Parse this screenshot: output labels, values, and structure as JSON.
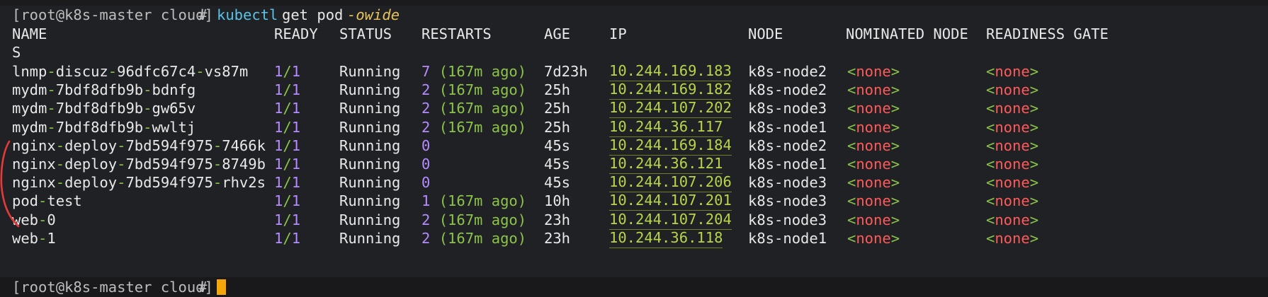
{
  "terminal": {
    "prompt_user_host": "[root@k8s-master cloud]",
    "prompt_symbol": "#",
    "command": "kubectl",
    "command_args": "get pod",
    "command_flag": "-owide",
    "headers": {
      "name": "NAME",
      "ready": "READY",
      "status": "STATUS",
      "restarts": "RESTARTS",
      "age": "AGE",
      "ip": "IP",
      "node": "NODE",
      "nominated_node": "NOMINATED NODE",
      "readiness_gate": "READINESS GATE",
      "readiness_gate_tail": "S"
    },
    "rows": [
      {
        "name_a": "lnmp",
        "name_b": "discuz",
        "name_c": "96dfc67c4",
        "name_d": "vs87m",
        "ready_num": "1",
        "ready_den": "1",
        "status": "Running",
        "restarts": "7",
        "ago": "(167m ago)",
        "age": "7d23h",
        "ip": "10.244.169.183",
        "node": "k8s-node2",
        "nominated": "none",
        "readiness": "none"
      },
      {
        "name_a": "mydm",
        "name_b": "7bdf8dfb9b",
        "name_c": "bdnfg",
        "name_d": "",
        "ready_num": "1",
        "ready_den": "1",
        "status": "Running",
        "restarts": "2",
        "ago": "(167m ago)",
        "age": "25h",
        "ip": "10.244.169.182",
        "node": "k8s-node2",
        "nominated": "none",
        "readiness": "none"
      },
      {
        "name_a": "mydm",
        "name_b": "7bdf8dfb9b",
        "name_c": "gw65v",
        "name_d": "",
        "ready_num": "1",
        "ready_den": "1",
        "status": "Running",
        "restarts": "2",
        "ago": "(167m ago)",
        "age": "25h",
        "ip": "10.244.107.202",
        "node": "k8s-node3",
        "nominated": "none",
        "readiness": "none"
      },
      {
        "name_a": "mydm",
        "name_b": "7bdf8dfb9b",
        "name_c": "wwltj",
        "name_d": "",
        "ready_num": "1",
        "ready_den": "1",
        "status": "Running",
        "restarts": "2",
        "ago": "(167m ago)",
        "age": "25h",
        "ip": "10.244.36.117",
        "node": "k8s-node1",
        "nominated": "none",
        "readiness": "none"
      },
      {
        "name_a": "nginx",
        "name_b": "deploy",
        "name_c": "7bd594f975",
        "name_d": "7466k",
        "ready_num": "1",
        "ready_den": "1",
        "status": "Running",
        "restarts": "0",
        "ago": "",
        "age": "45s",
        "ip": "10.244.169.184",
        "node": "k8s-node2",
        "nominated": "none",
        "readiness": "none"
      },
      {
        "name_a": "nginx",
        "name_b": "deploy",
        "name_c": "7bd594f975",
        "name_d": "8749b",
        "ready_num": "1",
        "ready_den": "1",
        "status": "Running",
        "restarts": "0",
        "ago": "",
        "age": "45s",
        "ip": "10.244.36.121",
        "node": "k8s-node1",
        "nominated": "none",
        "readiness": "none"
      },
      {
        "name_a": "nginx",
        "name_b": "deploy",
        "name_c": "7bd594f975",
        "name_d": "rhv2s",
        "ready_num": "1",
        "ready_den": "1",
        "status": "Running",
        "restarts": "0",
        "ago": "",
        "age": "45s",
        "ip": "10.244.107.206",
        "node": "k8s-node3",
        "nominated": "none",
        "readiness": "none"
      },
      {
        "name_a": "pod",
        "name_b": "test",
        "name_c": "",
        "name_d": "",
        "ready_num": "1",
        "ready_den": "1",
        "status": "Running",
        "restarts": "1",
        "ago": "(167m ago)",
        "age": "10h",
        "ip": "10.244.107.201",
        "node": "k8s-node3",
        "nominated": "none",
        "readiness": "none"
      },
      {
        "name_a": "web",
        "name_b": "0",
        "name_c": "",
        "name_d": "",
        "ready_num": "1",
        "ready_den": "1",
        "status": "Running",
        "restarts": "2",
        "ago": "(167m ago)",
        "age": "23h",
        "ip": "10.244.107.204",
        "node": "k8s-node3",
        "nominated": "none",
        "readiness": "none"
      },
      {
        "name_a": "web",
        "name_b": "1",
        "name_c": "",
        "name_d": "",
        "ready_num": "1",
        "ready_den": "1",
        "status": "Running",
        "restarts": "2",
        "ago": "(167m ago)",
        "age": "23h",
        "ip": "10.244.36.118",
        "node": "k8s-node1",
        "nominated": "none",
        "readiness": "none"
      }
    ],
    "colors": {
      "background": "#202124",
      "command": "#59c2e6",
      "flag": "#e8c45a",
      "ip": "#b8d44a",
      "ratio": "#b48cff",
      "none_text": "#ff5a5a",
      "cursor": "#f5a70a",
      "annotation": "#e23b3b"
    },
    "icons": {
      "cursor": "block-cursor",
      "annotation": "red-hand-drawn-bracket"
    }
  }
}
